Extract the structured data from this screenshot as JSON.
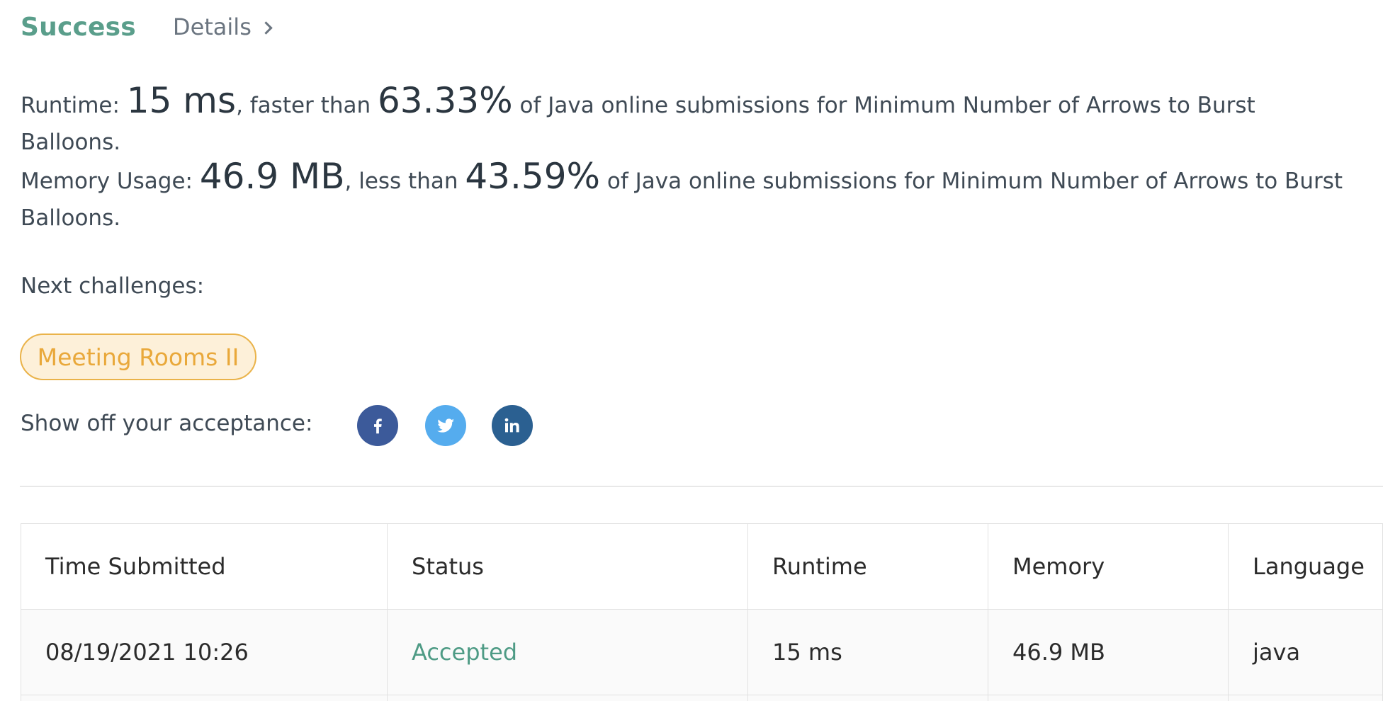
{
  "header": {
    "status_title": "Success",
    "details_label": "Details"
  },
  "runtime_line": {
    "prefix": "Runtime: ",
    "value": "15 ms",
    "middle": ", faster than ",
    "percent": "63.33%",
    "suffix": " of Java online submissions for Minimum Number of Arrows to Burst Balloons."
  },
  "memory_line": {
    "prefix": "Memory Usage: ",
    "value": "46.9 MB",
    "middle": ", less than ",
    "percent": "43.59%",
    "suffix": " of Java online submissions for Minimum Number of Arrows to Burst Balloons."
  },
  "next_challenges": {
    "label": "Next challenges:",
    "items": [
      "Meeting Rooms II"
    ]
  },
  "share": {
    "label": "Show off your acceptance:",
    "icons": [
      "facebook-icon",
      "twitter-icon",
      "linkedin-icon"
    ],
    "colors": {
      "facebook": "#3c5a9a",
      "twitter": "#55acee",
      "linkedin": "#2b6091"
    }
  },
  "table": {
    "headers": [
      "Time Submitted",
      "Status",
      "Runtime",
      "Memory",
      "Language"
    ],
    "rows": [
      [
        "08/19/2021 10:26",
        "Accepted",
        "15 ms",
        "46.9 MB",
        "java"
      ]
    ]
  },
  "colors": {
    "success": "#5a9e8b",
    "accepted": "#4e9b85",
    "pill_border": "#eab34a",
    "pill_bg": "#fdf0d9"
  }
}
